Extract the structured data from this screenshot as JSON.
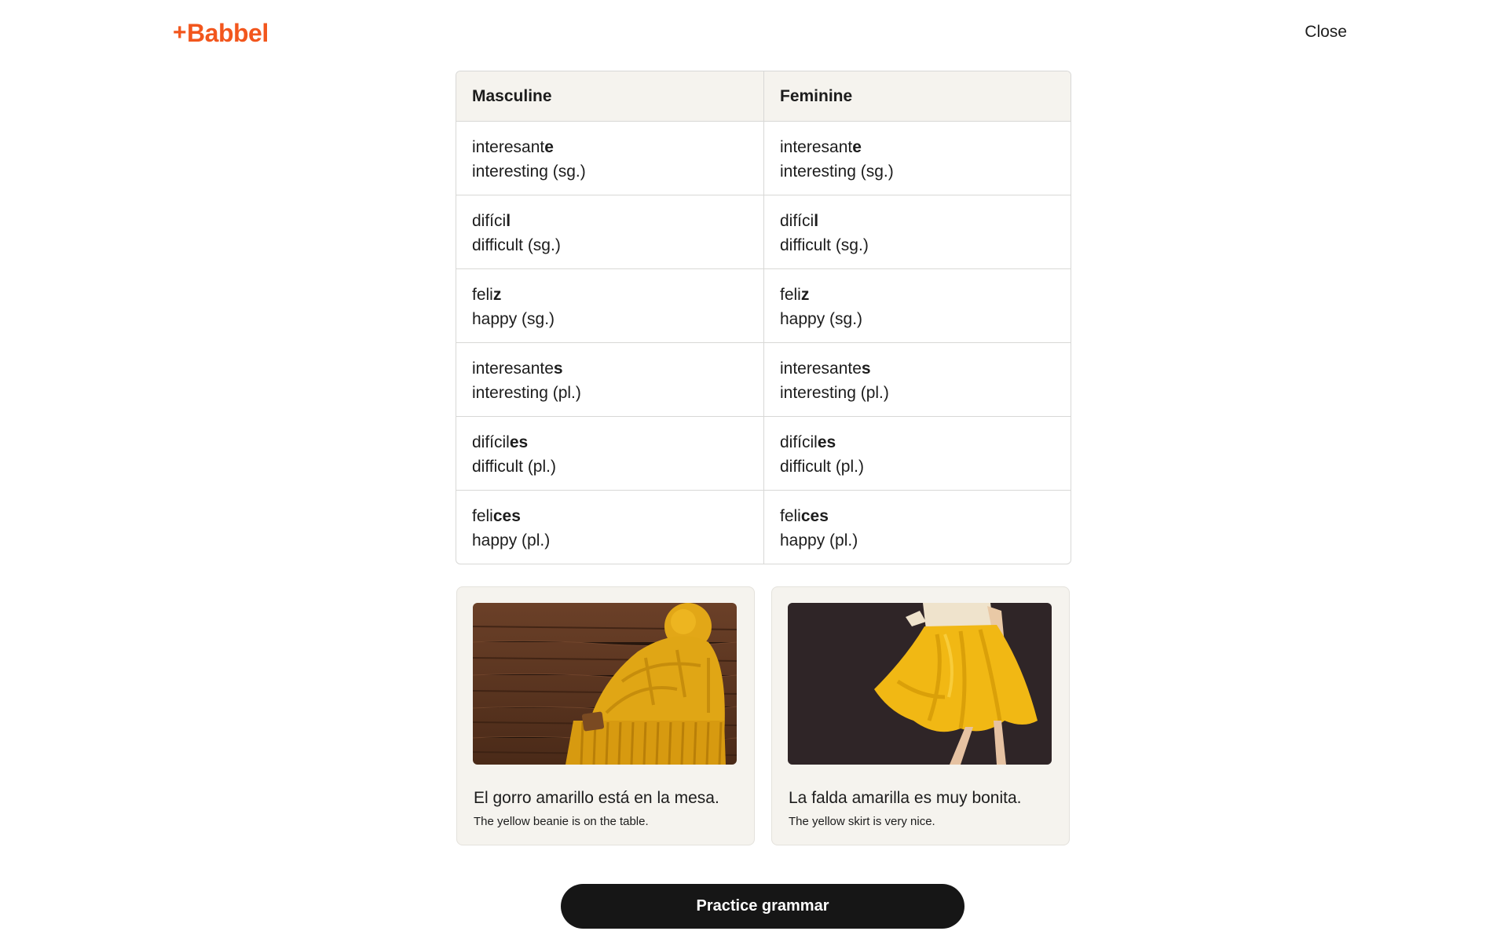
{
  "header": {
    "logo_text": "Babbel",
    "logo_plus": "+",
    "close_label": "Close",
    "brand_color": "#f2561d"
  },
  "table": {
    "headers": [
      "Masculine",
      "Feminine"
    ],
    "rows": [
      {
        "masculine": {
          "stem": "interesant",
          "ending": "e",
          "translation": "interesting (sg.)"
        },
        "feminine": {
          "stem": "interesant",
          "ending": "e",
          "translation": "interesting (sg.)"
        }
      },
      {
        "masculine": {
          "stem": "difíci",
          "ending": "l",
          "translation": "difficult (sg.)"
        },
        "feminine": {
          "stem": "difíci",
          "ending": "l",
          "translation": "difficult (sg.)"
        }
      },
      {
        "masculine": {
          "stem": "feli",
          "ending": "z",
          "translation": "happy (sg.)"
        },
        "feminine": {
          "stem": "feli",
          "ending": "z",
          "translation": "happy (sg.)"
        }
      },
      {
        "masculine": {
          "stem": "interesante",
          "ending": "s",
          "translation": "interesting (pl.)"
        },
        "feminine": {
          "stem": "interesante",
          "ending": "s",
          "translation": "interesting (pl.)"
        }
      },
      {
        "masculine": {
          "stem": "difícil",
          "ending": "es",
          "translation": "difficult (pl.)"
        },
        "feminine": {
          "stem": "difícil",
          "ending": "es",
          "translation": "difficult (pl.)"
        }
      },
      {
        "masculine": {
          "stem": "feli",
          "ending": "ces",
          "translation": "happy (pl.)"
        },
        "feminine": {
          "stem": "feli",
          "ending": "ces",
          "translation": "happy (pl.)"
        }
      }
    ]
  },
  "cards": [
    {
      "image_icon": "yellow-beanie-image",
      "sentence": "El gorro amarillo está en la mesa.",
      "translation": "The yellow beanie is on the table."
    },
    {
      "image_icon": "yellow-skirt-image",
      "sentence": "La falda amarilla es muy bonita.",
      "translation": "The yellow skirt is very nice."
    }
  ],
  "footer": {
    "practice_label": "Practice grammar"
  }
}
